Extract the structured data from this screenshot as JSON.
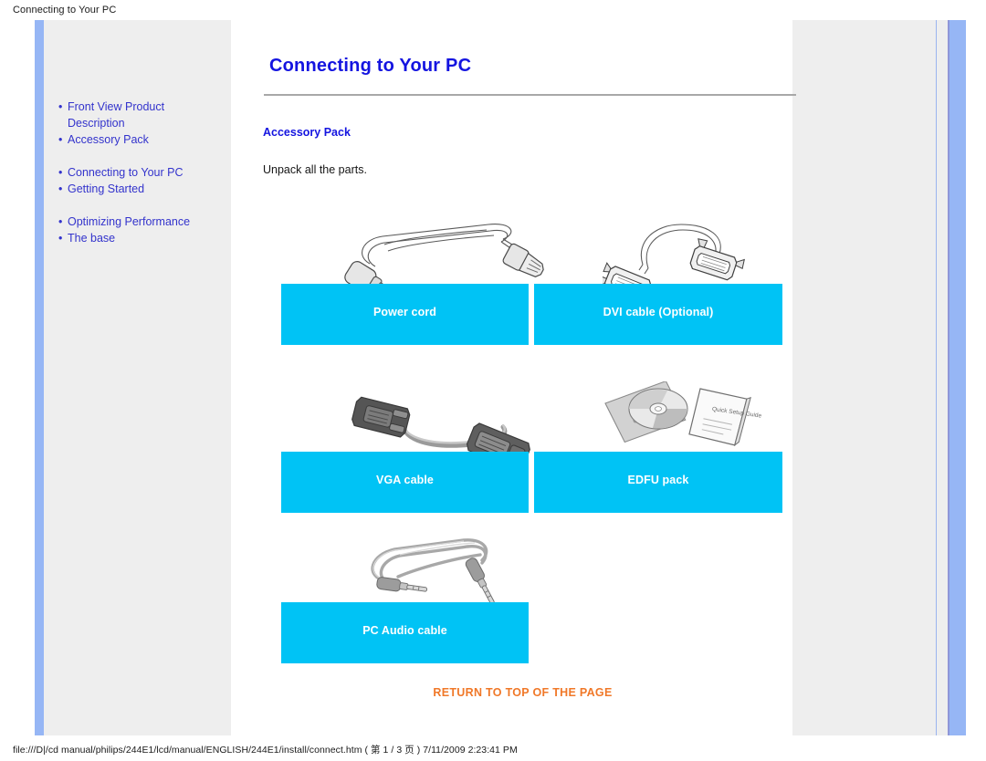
{
  "window": {
    "title": "Connecting to Your PC",
    "status_text": "file:///D|/cd manual/philips/244E1/lcd/manual/ENGLISH/244E1/install/connect.htm ( 第 1 / 3 页 ) 7/11/2009 2:23:41 PM"
  },
  "theme": {
    "link_blue": "#3333cc",
    "heading_blue": "#1414e0",
    "caption_cyan": "#00c3f5",
    "accent_bar_blue": "#96b6f5",
    "return_link_orange": "#f07828",
    "panel_gray": "#eeeeee"
  },
  "sidebar": {
    "items": [
      {
        "label": "Front View Product Description"
      },
      {
        "label": "Accessory Pack"
      },
      {
        "label": "Connecting to Your PC"
      },
      {
        "label": "Getting Started"
      },
      {
        "label": "Optimizing Performance"
      },
      {
        "label": "The base"
      }
    ]
  },
  "main": {
    "page_title": "Connecting to Your PC",
    "section_title": "Accessory Pack",
    "intro_text": "Unpack all the parts.",
    "return_link": "RETURN TO TOP OF THE PAGE",
    "items": [
      {
        "caption": "Power cord",
        "figure": "power-cord-illustration"
      },
      {
        "caption": "DVI cable (Optional)",
        "figure": "dvi-cable-illustration"
      },
      {
        "caption": "VGA cable",
        "figure": "vga-cable-photo"
      },
      {
        "caption": "EDFU pack",
        "figure": "edfu-pack-photo"
      },
      {
        "caption": "PC Audio cable",
        "figure": "audio-cable-photo"
      }
    ],
    "edfu_labels": {
      "disc_sleeve": "CD-ROM",
      "booklet": "Quick Setup Guide"
    }
  }
}
